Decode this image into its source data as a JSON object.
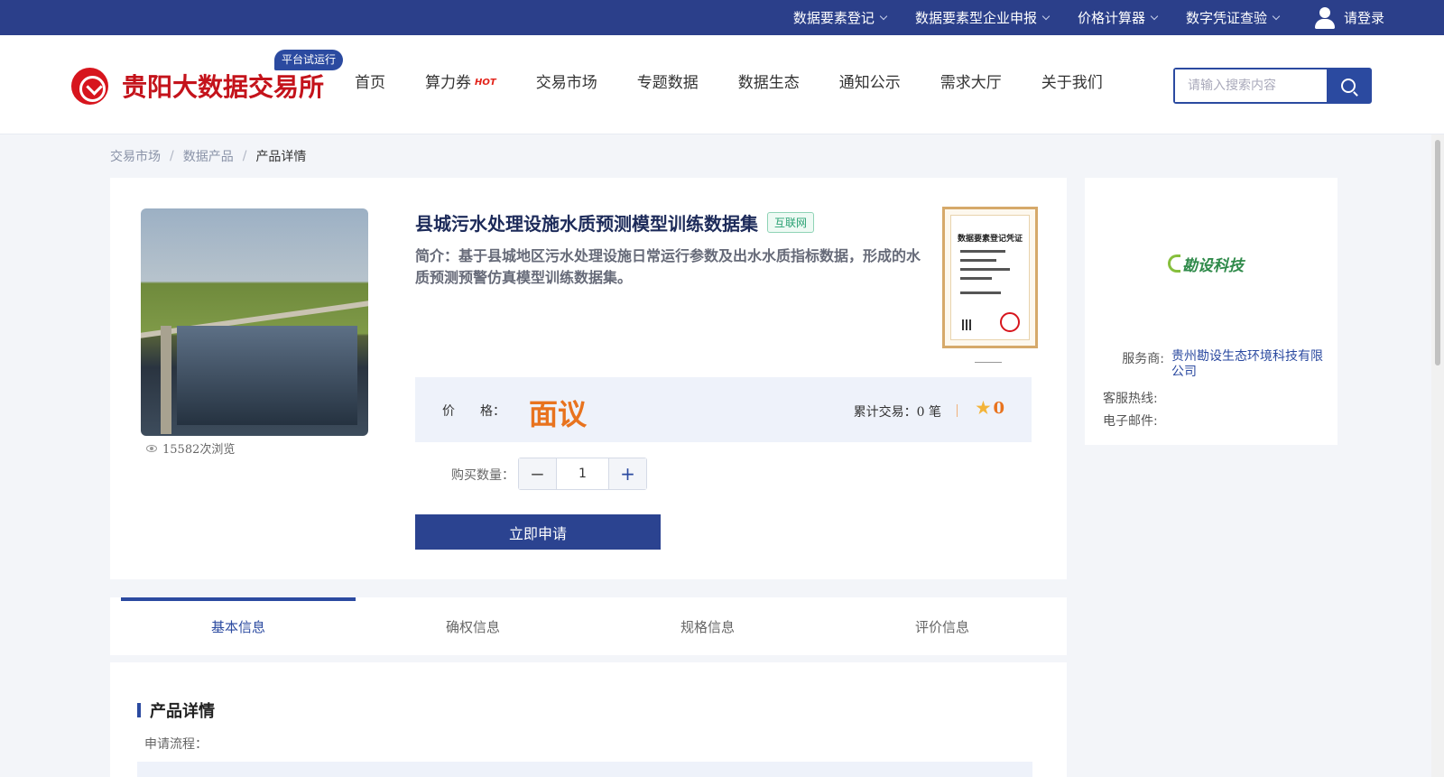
{
  "topbar": {
    "items": [
      {
        "label": "数据要素登记"
      },
      {
        "label": "数据要素型企业申报"
      },
      {
        "label": "价格计算器"
      },
      {
        "label": "数字凭证查验"
      }
    ],
    "login_label": "请登录"
  },
  "header": {
    "logo_text": "贵阳大数据交易所",
    "trial_badge": "平台试运行",
    "nav": [
      {
        "label": "首页"
      },
      {
        "label": "算力券",
        "badge": "HOT"
      },
      {
        "label": "交易市场"
      },
      {
        "label": "专题数据"
      },
      {
        "label": "数据生态"
      },
      {
        "label": "通知公示"
      },
      {
        "label": "需求大厅"
      },
      {
        "label": "关于我们"
      }
    ],
    "search": {
      "placeholder": "请输入搜索内容",
      "value": ""
    }
  },
  "breadcrumb": {
    "items": [
      "交易市场",
      "数据产品"
    ],
    "separator": "/",
    "current": "产品详情"
  },
  "product": {
    "title": "县城污水处理设施水质预测模型训练数据集",
    "tag": "互联网",
    "summary": "简介：基于县城地区污水处理设施日常运行参数及出水水质指标数据，形成的水质预测预警仿真模型训练数据集。",
    "views": "15582次浏览",
    "certificate_title": "数据要素登记凭证",
    "price_label": "价　　格：",
    "price_value": "面议",
    "trades": "累计交易：0 笔",
    "rating": "0",
    "quantity_label": "购买数量：",
    "quantity": "1",
    "apply_label": "立即申请"
  },
  "provider": {
    "logo_text": "勘设科技",
    "service_label": "服务商:",
    "service_value": "贵州勘设生态环境科技有限公司",
    "hotline_label": "客服热线:",
    "hotline_value": "",
    "email_label": "电子邮件:",
    "email_value": ""
  },
  "tabs": [
    {
      "label": "基本信息",
      "active": true
    },
    {
      "label": "确权信息",
      "active": false
    },
    {
      "label": "规格信息",
      "active": false
    },
    {
      "label": "评价信息",
      "active": false
    }
  ],
  "details": {
    "section_title": "产品详情",
    "process_label": "申请流程："
  },
  "colors": {
    "primary": "#2b3f8a",
    "accent": "#e8731e",
    "brand_red": "#c4131b",
    "tag_green": "#2aa173"
  }
}
